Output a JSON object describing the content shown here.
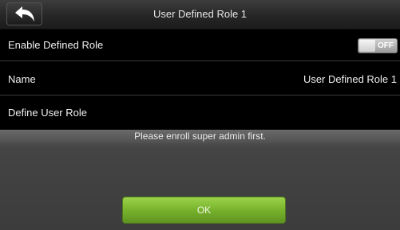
{
  "header": {
    "title": "User Defined Role 1",
    "back_icon": "back-arrow-icon"
  },
  "rows": [
    {
      "label": "Enable Defined Role",
      "toggle": {
        "state_label": "OFF",
        "on": false
      }
    },
    {
      "label": "Name",
      "value": "User Defined Role 1"
    },
    {
      "label": "Define User Role"
    }
  ],
  "dialog": {
    "message": "Please enroll super admin first.",
    "ok_label": "OK"
  },
  "colors": {
    "accent_button": "#78b22c",
    "background": "#000000"
  }
}
